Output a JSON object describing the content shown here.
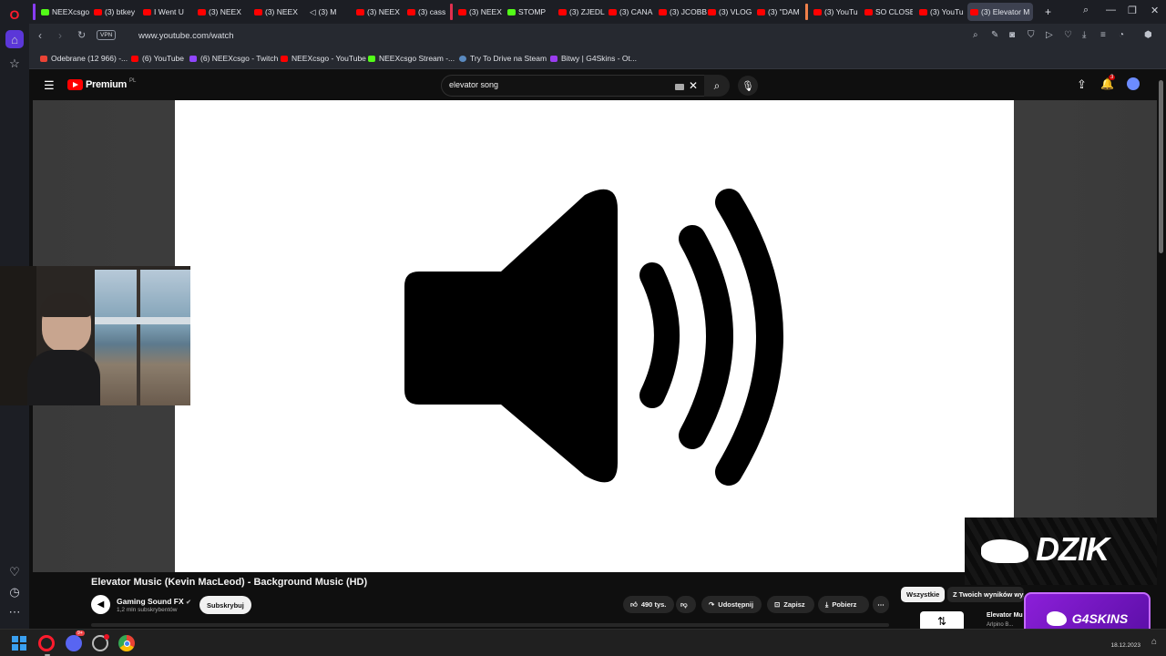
{
  "browser": {
    "tabs": [
      {
        "label": "NEEXcsgo",
        "favicon": "kick"
      },
      {
        "label": "(3) btkey",
        "favicon": "youtube"
      },
      {
        "label": "I Went U",
        "favicon": "youtube"
      },
      {
        "label": "(3) NEEX",
        "favicon": "youtube"
      },
      {
        "label": "(3) NEEX",
        "favicon": "youtube"
      },
      {
        "label": "(3) M",
        "favicon": "speaker"
      },
      {
        "label": "(3) NEEX",
        "favicon": "youtube"
      },
      {
        "label": "(3) cass",
        "favicon": "youtube"
      },
      {
        "label": "(3) NEEX",
        "favicon": "youtube"
      },
      {
        "label": "STOMP",
        "favicon": "kick"
      },
      {
        "label": "(3) ZJEDL",
        "favicon": "youtube"
      },
      {
        "label": "(3) CANA",
        "favicon": "youtube"
      },
      {
        "label": "(3) JCOBB",
        "favicon": "youtube"
      },
      {
        "label": "(3) VLOG",
        "favicon": "youtube"
      },
      {
        "label": "(3) \"DAM",
        "favicon": "youtube"
      },
      {
        "label": "(3) YouTu",
        "favicon": "youtube"
      },
      {
        "label": "SO CLOSE",
        "favicon": "youtube"
      },
      {
        "label": "(3) YouTu",
        "favicon": "youtube"
      },
      {
        "label": "(3) Elevator M",
        "favicon": "speaker",
        "active": true
      }
    ],
    "new_tab": "+",
    "url": "www.youtube.com/watch",
    "vpn_label": "VPN",
    "bookmarks": [
      {
        "label": "Odebrane (12 966) -...",
        "favicon": "gmail"
      },
      {
        "label": "(6) YouTube",
        "favicon": "youtube"
      },
      {
        "label": "(6) NEEXcsgo - Twitch",
        "favicon": "twitch"
      },
      {
        "label": "NEEXcsgo - YouTube",
        "favicon": "youtube"
      },
      {
        "label": "NEEXcsgo Stream -...",
        "favicon": "kick"
      },
      {
        "label": "Try To Drive na Steam",
        "favicon": "steam"
      },
      {
        "label": "Bitwy | G4Skins - Ot...",
        "favicon": "g4skins"
      }
    ]
  },
  "youtube": {
    "logo_text": "Premium",
    "logo_region": "PL",
    "search_value": "elevator song",
    "notification_count": "3",
    "video_title": "Elevator Music (Kevin MacLeod) - Background Music (HD)",
    "channel_name": "Gaming Sound FX",
    "channel_subs": "1,2 mln subskrybentów",
    "subscribe_label": "Subskrybuj",
    "like_count": "490 tys.",
    "share_label": "Udostępnij",
    "save_label": "Zapisz",
    "download_label": "Pobierz",
    "chip_all": "Wszystkie",
    "chip_yours": "Z Twoich wyników wyszukiwania",
    "rec_title": "Elevator Mu",
    "rec_channel": "Arlpino B..."
  },
  "overlays": {
    "dzik_text": "DZIK",
    "g4_text": "G4SKINS"
  },
  "taskbar": {
    "date": "18.12.2023",
    "discord_badge": "9+"
  }
}
